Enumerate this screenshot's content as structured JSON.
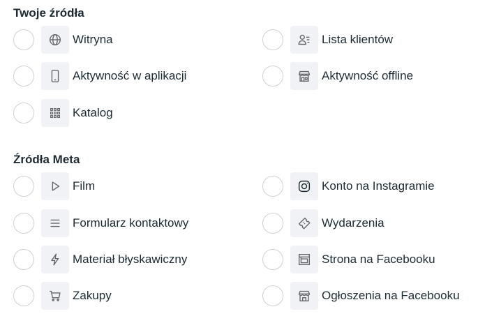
{
  "your_sources": {
    "title": "Twoje źródła",
    "options": [
      {
        "label": "Witryna",
        "icon": "globe-icon",
        "selected": false
      },
      {
        "label": "Lista klientów",
        "icon": "customer-list-icon",
        "selected": false
      },
      {
        "label": "Aktywność w aplikacji",
        "icon": "mobile-phone-icon",
        "selected": false
      },
      {
        "label": "Aktywność offline",
        "icon": "store-icon",
        "selected": false
      },
      {
        "label": "Katalog",
        "icon": "grid-icon",
        "selected": false
      }
    ]
  },
  "meta_sources": {
    "title": "Źródła Meta",
    "options": [
      {
        "label": "Film",
        "icon": "play-icon",
        "selected": false
      },
      {
        "label": "Konto na Instagramie",
        "icon": "instagram-icon",
        "selected": false
      },
      {
        "label": "Formularz kontaktowy",
        "icon": "lines-icon",
        "selected": false
      },
      {
        "label": "Wydarzenia",
        "icon": "ticket-icon",
        "selected": false
      },
      {
        "label": "Materiał błyskawiczny",
        "icon": "lightning-icon",
        "selected": false
      },
      {
        "label": "Strona na Facebooku",
        "icon": "facebook-page-icon",
        "selected": false
      },
      {
        "label": "Zakupy",
        "icon": "shopping-cart-icon",
        "selected": false
      },
      {
        "label": "Ogłoszenia na Facebooku",
        "icon": "marketplace-icon",
        "selected": false
      }
    ]
  },
  "colors": {
    "text": "#1c2b33",
    "icon_bg": "#f0f2f5",
    "icon_stroke": "#65676b",
    "radio_border": "#ccd0d5"
  }
}
